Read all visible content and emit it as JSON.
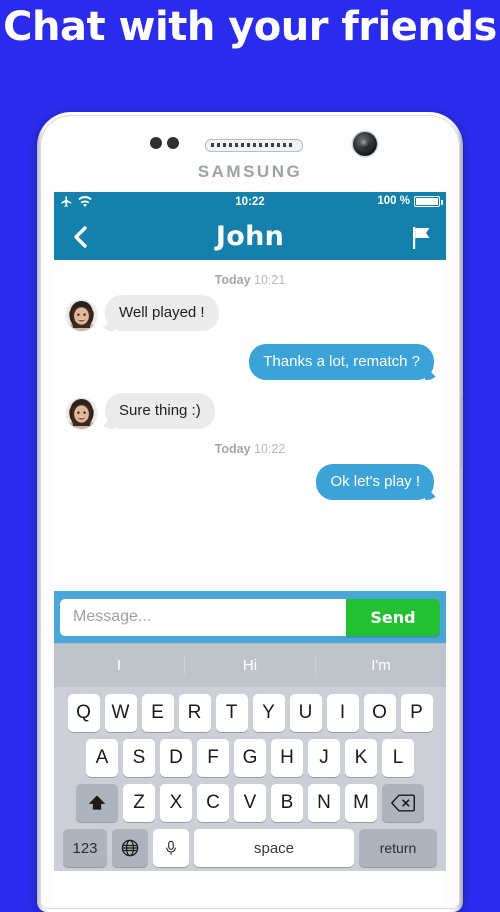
{
  "poster": {
    "headline": "Chat with your friends",
    "background_color": "#2b2bee"
  },
  "phone": {
    "brand": "SAMSUNG",
    "frame_color": "#ffffff"
  },
  "app": {
    "accent_color": "#1480ab",
    "sent_bubble_color": "#3ba3d8",
    "send_button_color": "#22c032",
    "statusbar": {
      "airplane_icon": "airplane-icon",
      "wifi_icon": "wifi-icon",
      "time": "10:22",
      "battery_percent": "100 %"
    },
    "navbar": {
      "back_icon": "chevron-left-icon",
      "title": "John",
      "flag_icon": "flag-icon"
    },
    "chat": {
      "groups": [
        {
          "stamp_label": "Today",
          "stamp_time": "10:21",
          "messages": [
            {
              "side": "them",
              "text": "Well played !",
              "avatar": "avatar-woman"
            },
            {
              "side": "me",
              "text": "Thanks a lot, rematch ?"
            },
            {
              "side": "them",
              "text": "Sure thing :)",
              "avatar": "avatar-woman"
            }
          ]
        },
        {
          "stamp_label": "Today",
          "stamp_time": "10:22",
          "messages": [
            {
              "side": "me",
              "text": "Ok let's play !"
            }
          ]
        }
      ]
    },
    "composer": {
      "placeholder": "Message...",
      "value": "",
      "send_label": "Send"
    }
  },
  "keyboard": {
    "predictions": [
      "I",
      "Hi",
      "I'm"
    ],
    "row1": [
      "Q",
      "W",
      "E",
      "R",
      "T",
      "Y",
      "U",
      "I",
      "O",
      "P"
    ],
    "row2": [
      "A",
      "S",
      "D",
      "F",
      "G",
      "H",
      "J",
      "K",
      "L"
    ],
    "row3": [
      "Z",
      "X",
      "C",
      "V",
      "B",
      "N",
      "M"
    ],
    "shift_icon": "shift-up-arrow-icon",
    "backspace_icon": "backspace-icon",
    "numbers_label": "123",
    "globe_icon": "globe-icon",
    "mic_icon": "microphone-icon",
    "space_label": "space",
    "return_label": "return"
  }
}
